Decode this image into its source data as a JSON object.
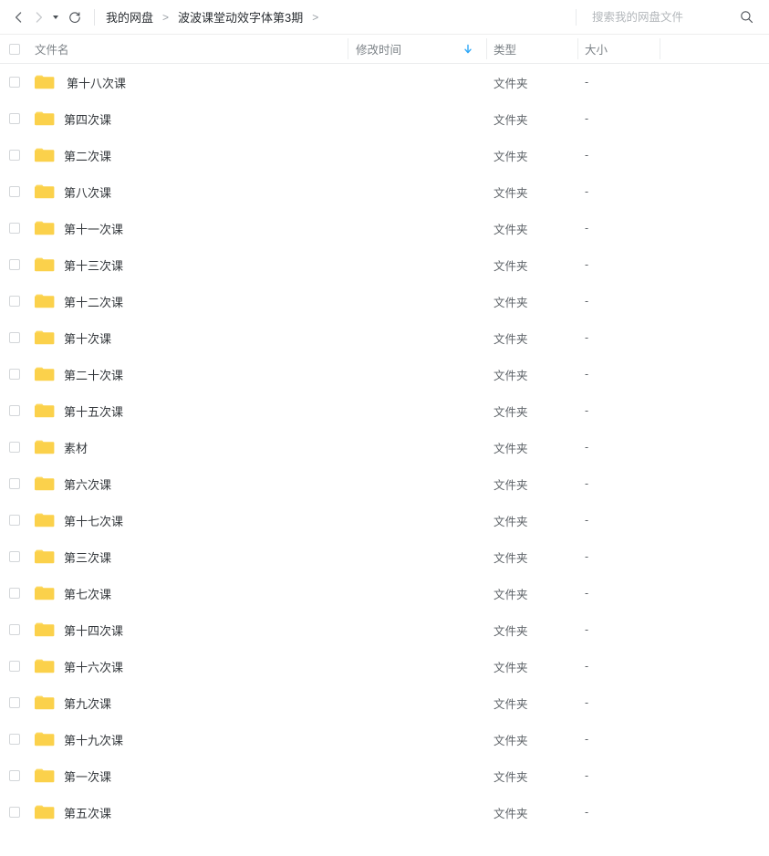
{
  "toolbar": {
    "back_icon": "chevron-left-icon",
    "forward_icon": "chevron-right-icon",
    "history_caret_icon": "caret-down-icon",
    "refresh_icon": "refresh-icon",
    "search_icon": "search-icon",
    "search_value": "",
    "search_placeholder": "搜索我的网盘文件"
  },
  "breadcrumb": {
    "separator": ">",
    "items": [
      {
        "label": "我的网盘"
      },
      {
        "label": "波波课堂动效字体第3期"
      }
    ]
  },
  "table": {
    "select_all_label": "",
    "headers": {
      "name": "文件名",
      "modified": "修改时间",
      "type": "类型",
      "size": "大小"
    },
    "sort": {
      "column": "修改时间",
      "direction": "desc",
      "icon": "arrow-down-icon",
      "color": "#2fa8f8"
    },
    "rows": [
      {
        "name": "第十八次课",
        "modified": "",
        "type": "文件夹",
        "size": "-",
        "icon": "folder-icon"
      },
      {
        "name": "第四次课",
        "modified": "",
        "type": "文件夹",
        "size": "-",
        "icon": "folder-icon"
      },
      {
        "name": "第二次课",
        "modified": "",
        "type": "文件夹",
        "size": "-",
        "icon": "folder-icon"
      },
      {
        "name": "第八次课",
        "modified": "",
        "type": "文件夹",
        "size": "-",
        "icon": "folder-icon"
      },
      {
        "name": "第十一次课",
        "modified": "",
        "type": "文件夹",
        "size": "-",
        "icon": "folder-icon"
      },
      {
        "name": "第十三次课",
        "modified": "",
        "type": "文件夹",
        "size": "-",
        "icon": "folder-icon"
      },
      {
        "name": "第十二次课",
        "modified": "",
        "type": "文件夹",
        "size": "-",
        "icon": "folder-icon"
      },
      {
        "name": "第十次课",
        "modified": "",
        "type": "文件夹",
        "size": "-",
        "icon": "folder-icon"
      },
      {
        "name": "第二十次课",
        "modified": "",
        "type": "文件夹",
        "size": "-",
        "icon": "folder-icon"
      },
      {
        "name": "第十五次课",
        "modified": "",
        "type": "文件夹",
        "size": "-",
        "icon": "folder-icon"
      },
      {
        "name": "素材",
        "modified": "",
        "type": "文件夹",
        "size": "-",
        "icon": "folder-icon"
      },
      {
        "name": "第六次课",
        "modified": "",
        "type": "文件夹",
        "size": "-",
        "icon": "folder-icon"
      },
      {
        "name": "第十七次课",
        "modified": "",
        "type": "文件夹",
        "size": "-",
        "icon": "folder-icon"
      },
      {
        "name": "第三次课",
        "modified": "",
        "type": "文件夹",
        "size": "-",
        "icon": "folder-icon"
      },
      {
        "name": "第七次课",
        "modified": "",
        "type": "文件夹",
        "size": "-",
        "icon": "folder-icon"
      },
      {
        "name": "第十四次课",
        "modified": "",
        "type": "文件夹",
        "size": "-",
        "icon": "folder-icon"
      },
      {
        "name": "第十六次课",
        "modified": "",
        "type": "文件夹",
        "size": "-",
        "icon": "folder-icon"
      },
      {
        "name": "第九次课",
        "modified": "",
        "type": "文件夹",
        "size": "-",
        "icon": "folder-icon"
      },
      {
        "name": "第十九次课",
        "modified": "",
        "type": "文件夹",
        "size": "-",
        "icon": "folder-icon"
      },
      {
        "name": "第一次课",
        "modified": "",
        "type": "文件夹",
        "size": "-",
        "icon": "folder-icon"
      },
      {
        "name": "第五次课",
        "modified": "",
        "type": "文件夹",
        "size": "-",
        "icon": "folder-icon"
      }
    ]
  },
  "colors": {
    "folder": "#fbd14b",
    "folder_tab": "#fcd95f",
    "accent": "#06a7ff",
    "sort_blue": "#2fa8f8",
    "text": "#33373b",
    "muted": "#7c8287",
    "border": "#ebedee"
  }
}
